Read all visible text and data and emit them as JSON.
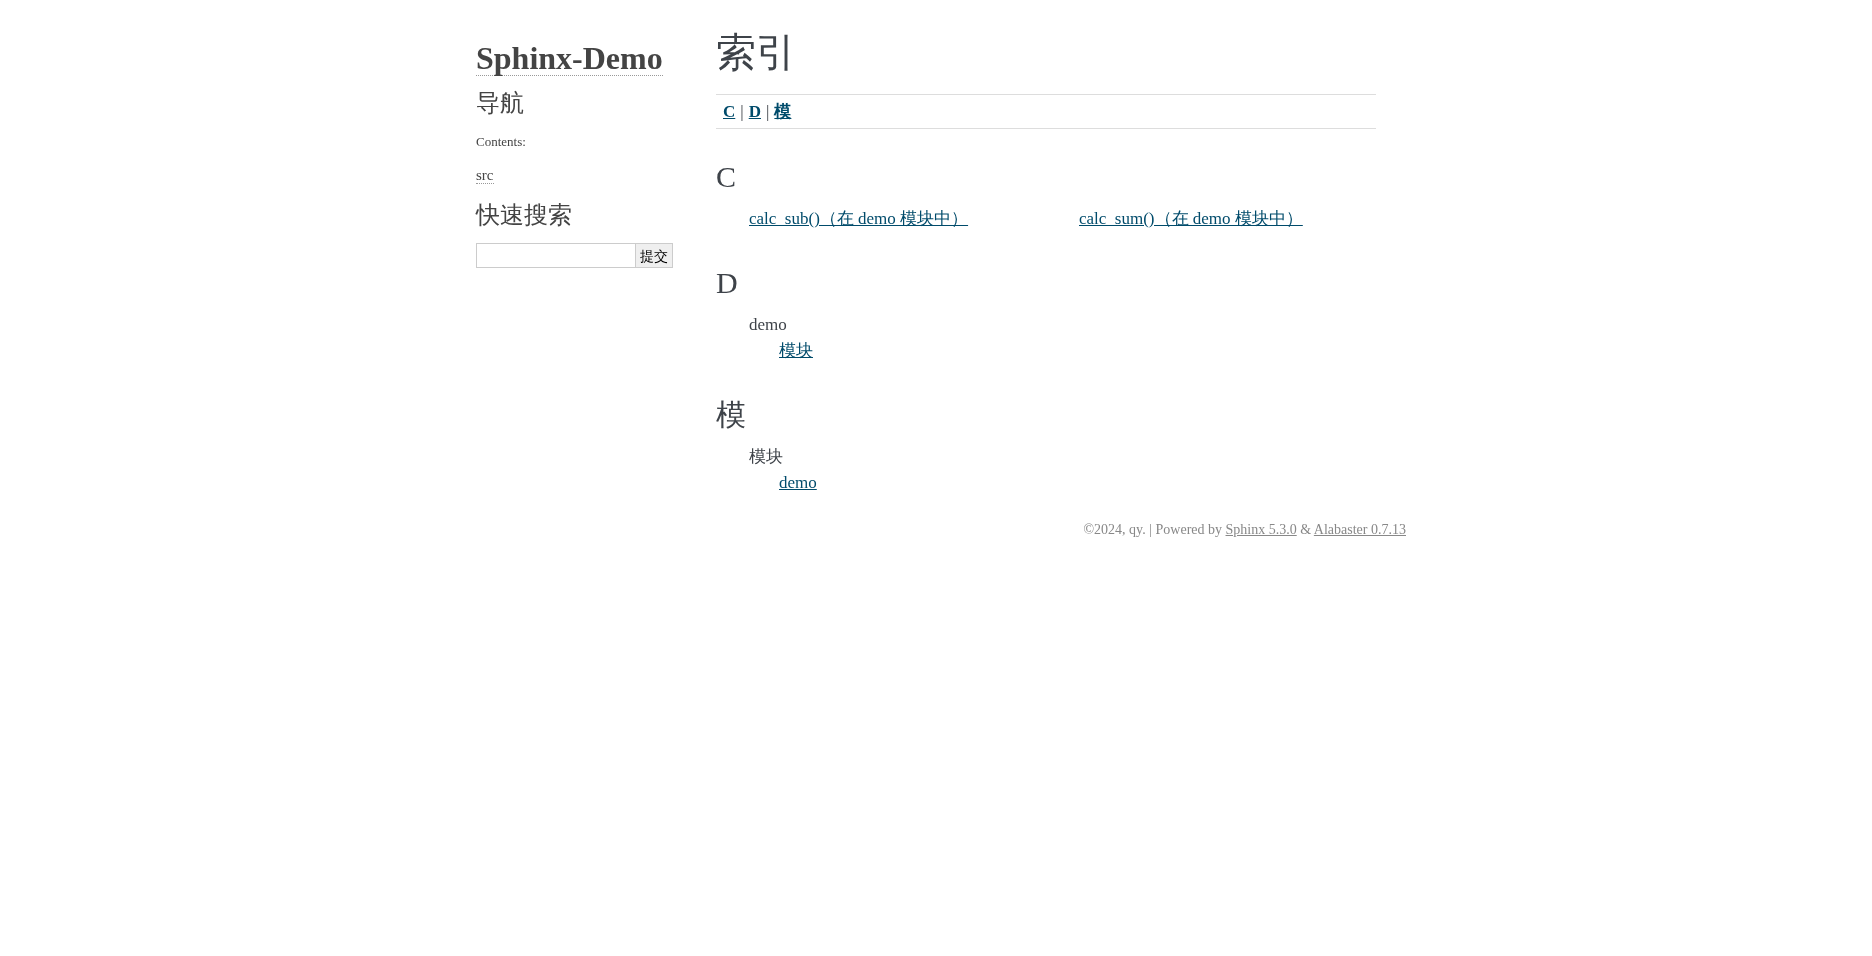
{
  "sidebar": {
    "logo": "Sphinx-Demo",
    "navigation": {
      "heading": "导航",
      "caption": "Contents:",
      "items": [
        {
          "label": "src"
        }
      ]
    },
    "quick_search": {
      "heading": "快速搜索",
      "button": "提交"
    }
  },
  "main": {
    "title": "索引",
    "jump_bar": [
      {
        "kind": "link",
        "text": "C"
      },
      {
        "kind": "separator",
        "text": "|"
      },
      {
        "kind": "link",
        "text": "D"
      },
      {
        "kind": "separator",
        "text": "|"
      },
      {
        "kind": "link",
        "text": "模"
      }
    ],
    "sections": [
      {
        "letter": "C",
        "columns": [
          {
            "entries": [
              {
                "kind": "link",
                "text": "calc_sub()（在 demo 模块中）"
              }
            ]
          },
          {
            "entries": [
              {
                "kind": "link",
                "text": "calc_sum()（在 demo 模块中）"
              }
            ]
          }
        ]
      },
      {
        "letter": "D",
        "columns": [
          {
            "entries": [
              {
                "kind": "term",
                "text": "demo",
                "children": [
                  {
                    "kind": "link",
                    "text": "模块"
                  }
                ]
              }
            ]
          }
        ]
      },
      {
        "letter": "模",
        "columns": [
          {
            "entries": [
              {
                "kind": "term",
                "text": "模块",
                "children": [
                  {
                    "kind": "link",
                    "text": "demo"
                  }
                ]
              }
            ]
          }
        ]
      }
    ]
  },
  "footer": [
    {
      "kind": "text",
      "text": "©2024, qy."
    },
    {
      "kind": "text",
      "text": "|"
    },
    {
      "kind": "text",
      "text": "Powered by"
    },
    {
      "kind": "link",
      "text": "Sphinx 5.3.0"
    },
    {
      "kind": "text",
      "text": "&"
    },
    {
      "kind": "link",
      "text": "Alabaster 0.7.13"
    }
  ]
}
